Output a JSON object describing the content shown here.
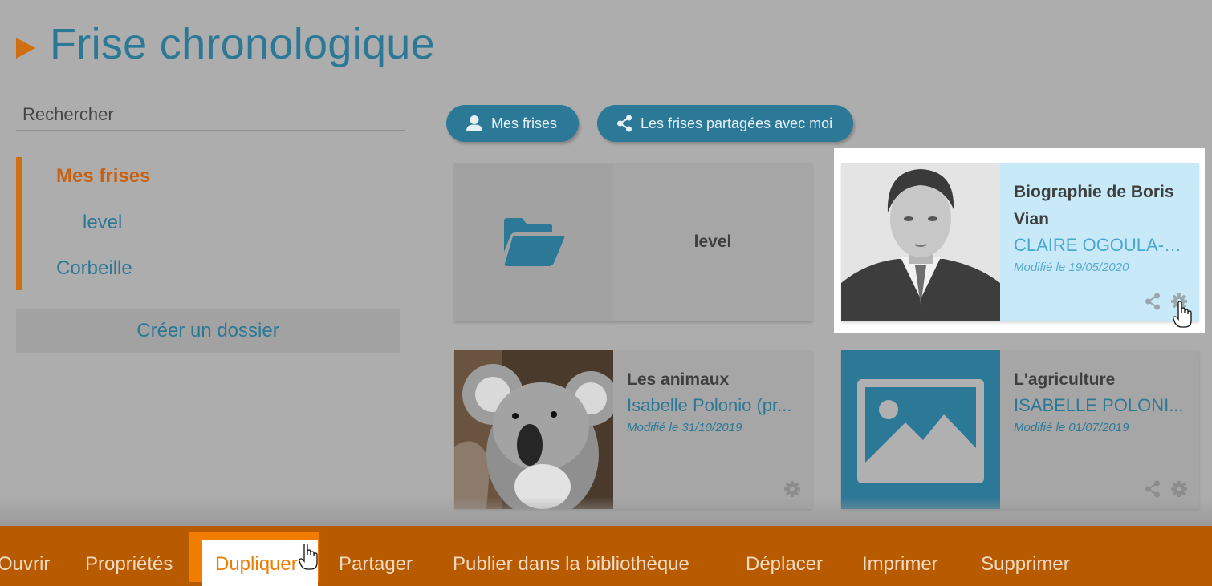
{
  "header": {
    "title": "Frise chronologique"
  },
  "search": {
    "placeholder": "Rechercher"
  },
  "sidebar": {
    "items": [
      {
        "label": "Mes frises"
      },
      {
        "label": "level"
      },
      {
        "label": "Corbeille"
      }
    ],
    "create_folder_label": "Créer un dossier"
  },
  "tabs": {
    "mine": "Mes frises",
    "shared": "Les frises partagées avec moi"
  },
  "cards": [
    {
      "type": "folder",
      "title": "level",
      "icon": "folder-open-icon"
    },
    {
      "type": "timeline",
      "title": "Biographie de Boris Vian",
      "author": "CLAIRE OGOULA-N...",
      "date": "Modifié le 19/05/2020",
      "selected": true,
      "icons": [
        "share-icon",
        "gear-icon"
      ]
    },
    {
      "type": "timeline",
      "title": "Les animaux",
      "author": "Isabelle Polonio (pr...",
      "date": "Modifié le 31/10/2019",
      "icons": [
        "gear-icon"
      ]
    },
    {
      "type": "timeline",
      "title": "L'agriculture",
      "author": "ISABELLE POLONI...",
      "date": "Modifié le 01/07/2019",
      "icons": [
        "share-icon",
        "gear-icon"
      ]
    }
  ],
  "actions": {
    "open": "Ouvrir",
    "properties": "Propriétés",
    "duplicate": "Dupliquer",
    "share": "Partager",
    "publish": "Publier dans la bibliothèque",
    "move": "Déplacer",
    "print": "Imprimer",
    "delete": "Supprimer"
  },
  "colors": {
    "accent_blue": "#2b7897",
    "accent_orange": "#d06e12",
    "action_bar": "#b85a00",
    "selected_card": "#c8e9f8"
  }
}
